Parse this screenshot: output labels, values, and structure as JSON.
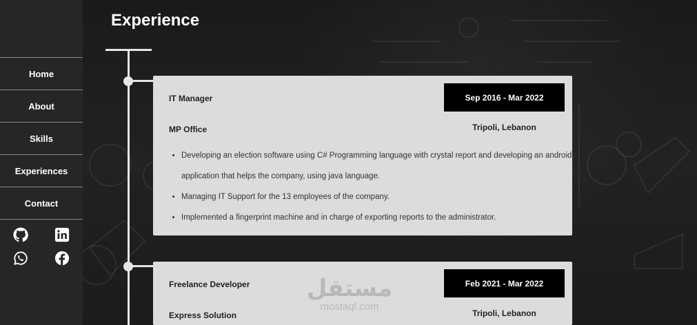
{
  "sidebar": {
    "nav": [
      {
        "label": "Home"
      },
      {
        "label": "About"
      },
      {
        "label": "Skills"
      },
      {
        "label": "Experiences"
      },
      {
        "label": "Contact"
      }
    ],
    "social_icons": [
      "github-icon",
      "linkedin-icon",
      "whatsapp-icon",
      "facebook-icon"
    ]
  },
  "main": {
    "title": "Experience",
    "experiences": [
      {
        "role": "IT Manager",
        "company": "MP Office",
        "date": "Sep 2016 - Mar 2022",
        "location": "Tripoli, Lebanon",
        "bullets": [
          "Developing an election software using C# Programming language with crystal report and developing an android application that helps the company, using java language.",
          "Managing IT Support for the 13 employees of the company.",
          "Implemented a fingerprint machine and in charge of exporting reports to the administrator."
        ]
      },
      {
        "role": "Freelance Developer",
        "company": "Express Solution",
        "date": "Feb 2021 - Mar 2022",
        "location": "Tripoli, Lebanon"
      }
    ]
  },
  "watermark": {
    "logo_text": "مستقل",
    "url_text": "mostaql.com"
  },
  "colors": {
    "sidebar_bg": "#262626",
    "card_bg": "#dcdcdc",
    "date_bg": "#000000",
    "timeline": "#e6e6e6"
  }
}
